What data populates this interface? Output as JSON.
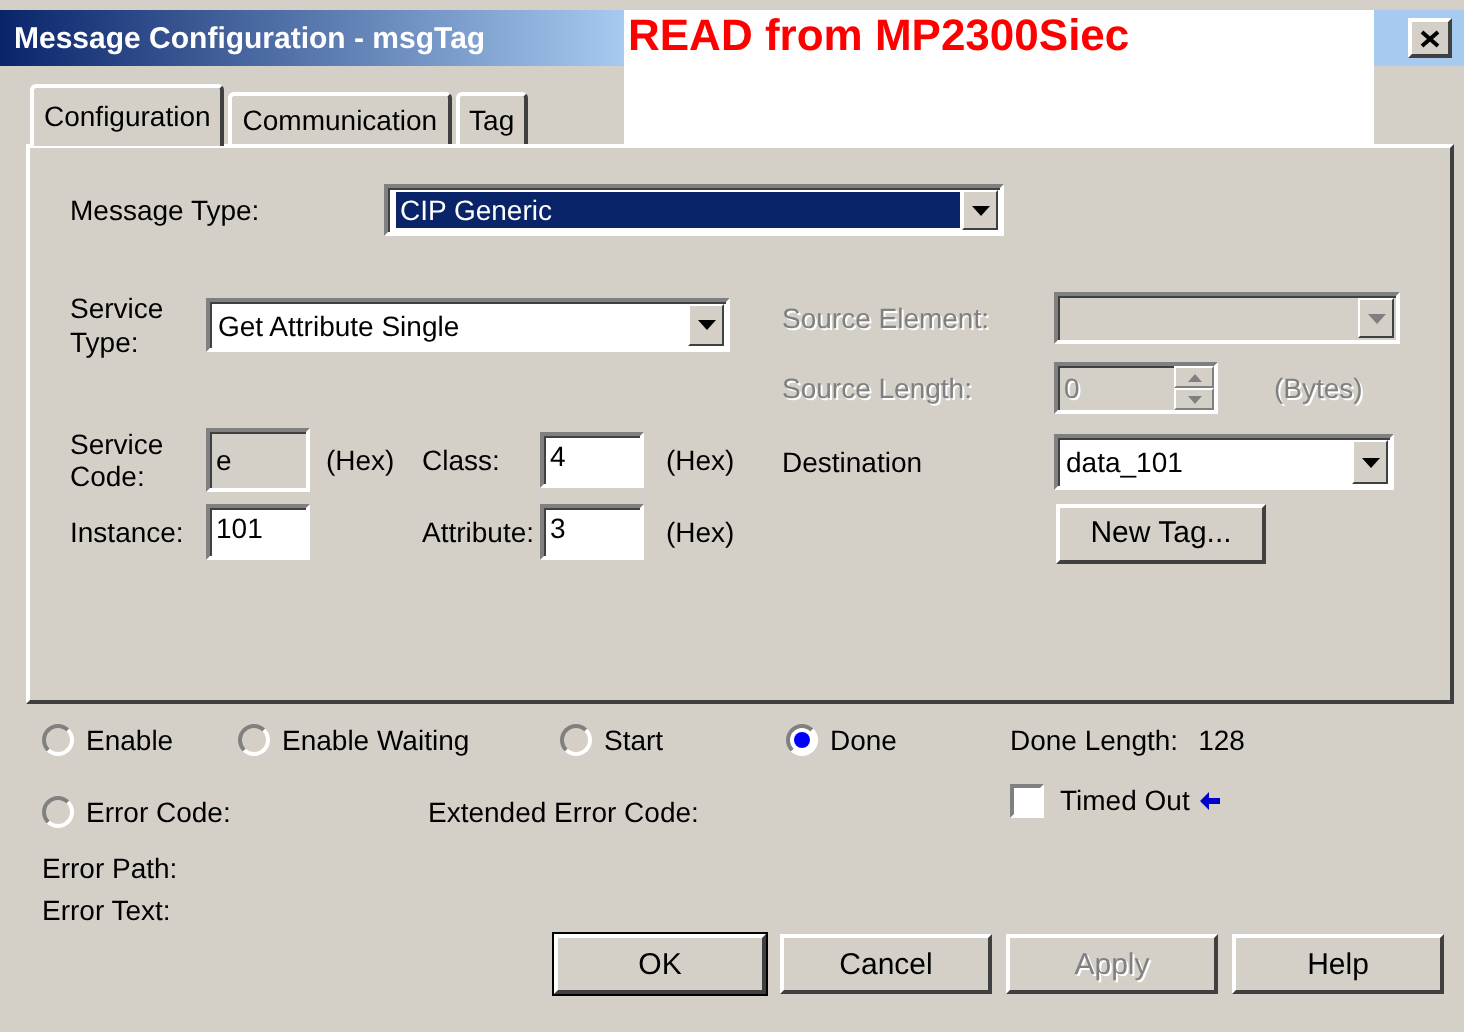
{
  "window": {
    "title": "Message Configuration - msgTag"
  },
  "annotation": {
    "text": "READ from MP2300Siec"
  },
  "tabs": [
    {
      "label": "Configuration",
      "selected": true
    },
    {
      "label": "Communication",
      "selected": false
    },
    {
      "label": "Tag",
      "selected": false
    }
  ],
  "message_type": {
    "label": "Message Type:",
    "value": "CIP Generic",
    "highlighted": true
  },
  "service_type": {
    "label": "Service Type:",
    "value": "Get Attribute Single"
  },
  "service_code": {
    "label": "Service Code:",
    "value": "e",
    "unit": "(Hex)",
    "read_only": true
  },
  "class": {
    "label": "Class:",
    "value": "4",
    "unit": "(Hex)"
  },
  "instance": {
    "label": "Instance:",
    "value": "101"
  },
  "attribute": {
    "label": "Attribute:",
    "value": "3",
    "unit": "(Hex)"
  },
  "source_element": {
    "label": "Source Element:",
    "disabled": true
  },
  "source_length": {
    "label": "Source Length:",
    "value": "0",
    "unit": "(Bytes)",
    "disabled": true
  },
  "destination": {
    "label": "Destination",
    "value": "data_101"
  },
  "new_tag_button": {
    "label": "New Tag..."
  },
  "status_flags": [
    {
      "label": "Enable",
      "selected": false
    },
    {
      "label": "Enable Waiting",
      "selected": false
    },
    {
      "label": "Start",
      "selected": false
    },
    {
      "label": "Done",
      "selected": true
    }
  ],
  "done_length": {
    "label": "Done Length:",
    "value": "128"
  },
  "error_code": {
    "label": "Error Code:",
    "selected": false
  },
  "extended_error_code": {
    "label": "Extended Error Code:"
  },
  "timed_out": {
    "label": "Timed Out",
    "checked": false
  },
  "error_path": {
    "label": "Error Path:"
  },
  "error_text": {
    "label": "Error Text:"
  },
  "buttons": [
    {
      "label": "OK",
      "default": true,
      "disabled": false
    },
    {
      "label": "Cancel",
      "default": false,
      "disabled": false
    },
    {
      "label": "Apply",
      "default": false,
      "disabled": true
    },
    {
      "label": "Help",
      "default": false,
      "disabled": false
    }
  ]
}
